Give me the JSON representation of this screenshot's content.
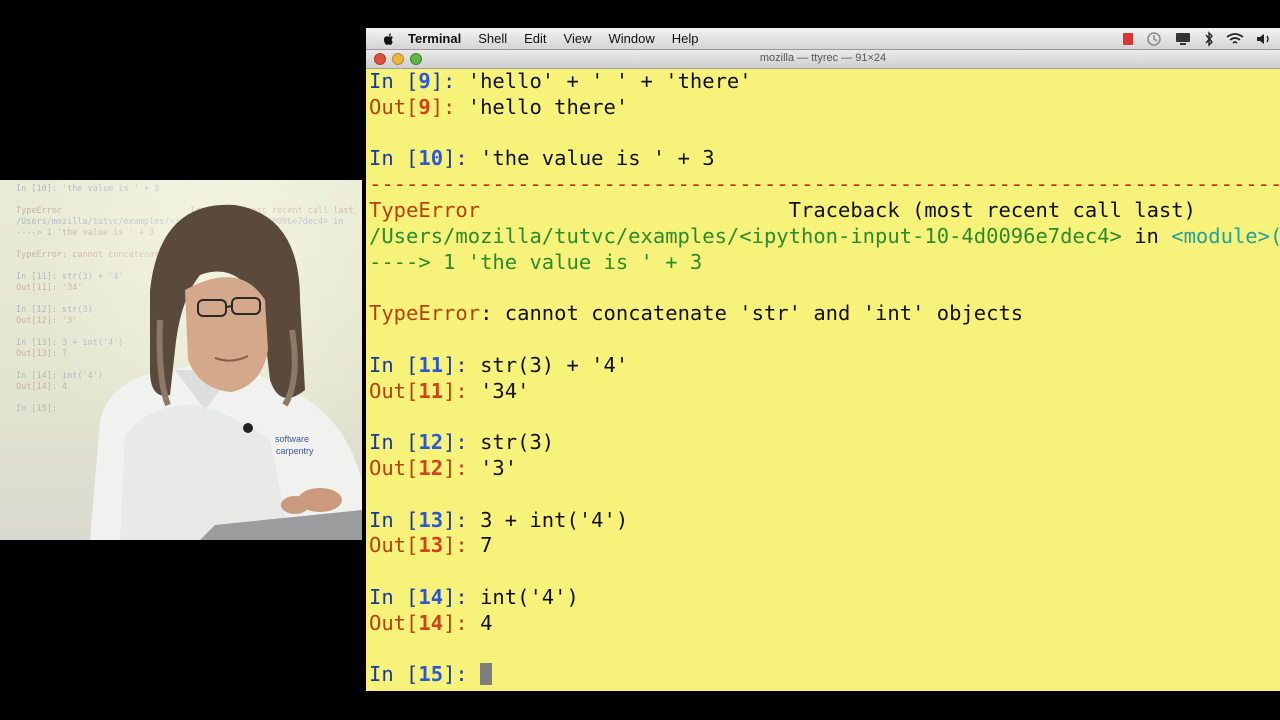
{
  "menubar": {
    "app_name": "Terminal",
    "items": [
      "Shell",
      "Edit",
      "View",
      "Window",
      "Help"
    ]
  },
  "window": {
    "title": "mozilla — ttyrec — 91×24"
  },
  "terminal": {
    "background": "#f7f27a",
    "lines": [
      {
        "kind": "in",
        "n": "9",
        "code": "'hello' + ' ' + 'there'"
      },
      {
        "kind": "out",
        "n": "9",
        "value": "'hello there'"
      },
      {
        "kind": "blank"
      },
      {
        "kind": "in",
        "n": "10",
        "code": "'the value is ' + 3"
      },
      {
        "kind": "dash",
        "text": "---------------------------------------------------------------------------"
      },
      {
        "kind": "tb_header",
        "name": "TypeError",
        "rest": "                         Traceback (most recent call last)"
      },
      {
        "kind": "tb_path",
        "path": "/Users/mozilla/tutvc/examples/<ipython-input-10-4d0096e7dec4>",
        "mid": " in ",
        "module": "<module>()"
      },
      {
        "kind": "tb_arrow",
        "arrow": "----> 1 ",
        "code": "'the value is ' + 3"
      },
      {
        "kind": "blank"
      },
      {
        "kind": "error",
        "name": "TypeError",
        "msg": ": cannot concatenate 'str' and 'int' objects"
      },
      {
        "kind": "blank"
      },
      {
        "kind": "in",
        "n": "11",
        "code": "str(3) + '4'"
      },
      {
        "kind": "out",
        "n": "11",
        "value": "'34'"
      },
      {
        "kind": "blank"
      },
      {
        "kind": "in",
        "n": "12",
        "code": "str(3)"
      },
      {
        "kind": "out",
        "n": "12",
        "value": "'3'"
      },
      {
        "kind": "blank"
      },
      {
        "kind": "in",
        "n": "13",
        "code": "3 + int('4')"
      },
      {
        "kind": "out",
        "n": "13",
        "value": "7"
      },
      {
        "kind": "blank"
      },
      {
        "kind": "in",
        "n": "14",
        "code": "int('4')"
      },
      {
        "kind": "out",
        "n": "14",
        "value": "4"
      },
      {
        "kind": "blank"
      },
      {
        "kind": "prompt",
        "n": "15"
      }
    ]
  },
  "video_screen": {
    "lines": [
      "In [10]: 'the value is ' + 3",
      "",
      "TypeError                         Traceback (most recent call last)",
      "/Users/mozilla/tutvc/examples/<ipython-input-10-4d0096e7dec4> in",
      "----> 1 'the value is ' + 3",
      "",
      "TypeError: cannot concatenate 'str' and 'int' objects",
      "",
      "In [11]: str(3) + '4'",
      "Out[11]: '34'",
      "",
      "In [12]: str(3)",
      "Out[12]: '3'",
      "",
      "In [13]: 3 + int('4')",
      "Out[13]: 7",
      "",
      "In [14]: int('4')",
      "Out[14]: 4",
      "",
      "In [15]:"
    ],
    "shirt_logo": "software carpentry"
  }
}
